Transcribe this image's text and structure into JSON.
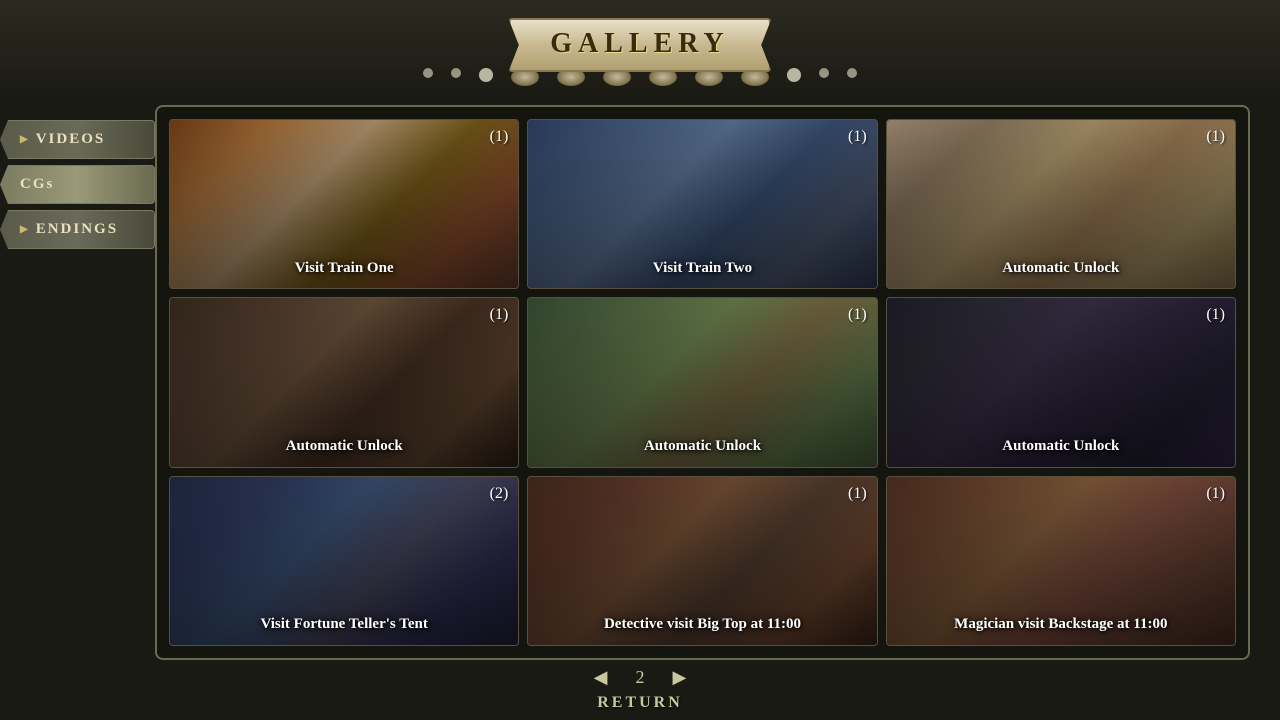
{
  "header": {
    "title": "GALLERY"
  },
  "sidebar": {
    "items": [
      {
        "id": "videos",
        "label": "VIDEOS",
        "active": false
      },
      {
        "id": "cgs",
        "label": "CGs",
        "active": true
      },
      {
        "id": "endings",
        "label": "ENDINGS",
        "active": false
      }
    ]
  },
  "gallery": {
    "cells": [
      {
        "id": 1,
        "count": "(1)",
        "label": "Visit\nTrain One",
        "bg_class": "cell-bg-1"
      },
      {
        "id": 2,
        "count": "(1)",
        "label": "Visit\nTrain Two",
        "bg_class": "cell-bg-2"
      },
      {
        "id": 3,
        "count": "(1)",
        "label": "Automatic\nUnlock",
        "bg_class": "cell-bg-3"
      },
      {
        "id": 4,
        "count": "(1)",
        "label": "Automatic\nUnlock",
        "bg_class": "cell-bg-4"
      },
      {
        "id": 5,
        "count": "(1)",
        "label": "Automatic\nUnlock",
        "bg_class": "cell-bg-5"
      },
      {
        "id": 6,
        "count": "(1)",
        "label": "Automatic\nUnlock",
        "bg_class": "cell-bg-6"
      },
      {
        "id": 7,
        "count": "(2)",
        "label": "Visit\nFortune Teller's Tent",
        "bg_class": "cell-bg-7"
      },
      {
        "id": 8,
        "count": "(1)",
        "label": "Detective visit\nBig Top at 11:00",
        "bg_class": "cell-bg-8"
      },
      {
        "id": 9,
        "count": "(1)",
        "label": "Magician visit\nBackstage at 11:00",
        "bg_class": "cell-bg-9"
      }
    ]
  },
  "pagination": {
    "current_page": 2,
    "prev_arrow": "◀",
    "next_arrow": "▶"
  },
  "return_label": "RETURN",
  "dots": [
    1,
    2,
    3,
    4,
    5,
    6,
    7,
    8,
    9,
    10,
    11
  ]
}
